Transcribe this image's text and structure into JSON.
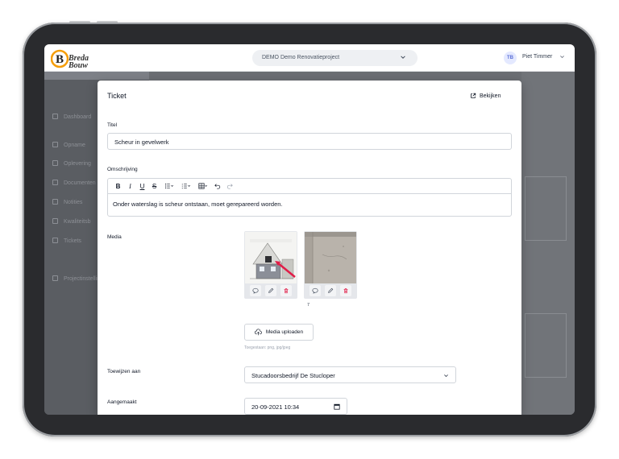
{
  "header": {
    "logo_text_1": "Breda",
    "logo_text_2": "Bouw",
    "project": "DEMO Demo Renovatieproject",
    "user_initials": "TB",
    "user_name": "Piet Timmer"
  },
  "sidebar": {
    "items": [
      {
        "label": "Dashboard",
        "icon": "home-icon"
      },
      {
        "label": "Opname",
        "icon": "clipboard-icon"
      },
      {
        "label": "Oplevering",
        "icon": "check-document-icon"
      },
      {
        "label": "Documenten",
        "icon": "folder-icon"
      },
      {
        "label": "Notities",
        "icon": "chat-icon"
      },
      {
        "label": "Kwaliteitsb",
        "icon": "building-icon"
      },
      {
        "label": "Tickets",
        "icon": "wrench-icon"
      },
      {
        "label": "Projectinstellingen",
        "icon": "folder-settings-icon"
      }
    ]
  },
  "modal": {
    "title": "Ticket",
    "view_label": "Bekijken",
    "title_label": "Titel",
    "title_value": "Scheur in gevelwerk",
    "description_label": "Omschrijving",
    "description_value": "Onder waterslag is scheur ontstaan, moet gerepareerd worden.",
    "toolbar": {
      "bold": "B",
      "italic": "I",
      "underline": "U",
      "strike": "S"
    },
    "media_label": "Media",
    "media": [
      {
        "caption": "",
        "kind": "house-drawing"
      },
      {
        "caption": "7",
        "kind": "wall-photo"
      }
    ],
    "upload_label": "Media uploaden",
    "allowed_types": "Toegestaan: png, jpg/jpeg",
    "assign_label": "Toewijzen aan",
    "assign_value": "Stucadoorsbedrijf De Stucloper",
    "created_label": "Aangemaakt",
    "created_value": "20-09-2021 10:34"
  },
  "colors": {
    "accent": "#5b6fd6",
    "danger": "#e11d48",
    "logo_orange": "#f59e0b"
  }
}
